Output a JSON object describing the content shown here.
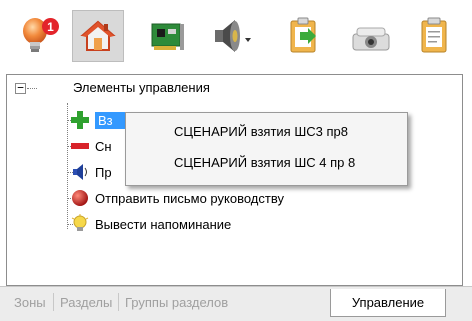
{
  "toolbar": {
    "notification_count": "1",
    "buttons": [
      {
        "name": "lightbulb-alert-icon"
      },
      {
        "name": "home-icon"
      },
      {
        "name": "network-card-icon"
      },
      {
        "name": "speaker-icon"
      },
      {
        "name": "clipboard-export-icon"
      },
      {
        "name": "camera-device-icon"
      },
      {
        "name": "clipboard-icon"
      }
    ]
  },
  "tree": {
    "root_expander": "−",
    "root_label": "Элементы управления",
    "items": [
      {
        "label": "Вз",
        "icon": "green-plus-icon"
      },
      {
        "label": "Сн",
        "icon": "red-minus-icon"
      },
      {
        "label": "Пр",
        "icon": "speaker-blue-icon"
      },
      {
        "label": "Отправить письмо руководству",
        "icon": "red-ball-icon"
      },
      {
        "label": "Вывести напоминание",
        "icon": "lightbulb-icon"
      }
    ]
  },
  "context_menu": {
    "items": [
      "СЦЕНАРИЙ взятия ШС3 пр8",
      "СЦЕНАРИЙ взятия ШС 4 пр 8"
    ]
  },
  "tabs": {
    "items": [
      "Зоны",
      "Разделы",
      "Группы разделов",
      "Управление"
    ],
    "active": "Управление"
  },
  "colors": {
    "selection": "#3399ff",
    "badge": "#e3242b"
  }
}
